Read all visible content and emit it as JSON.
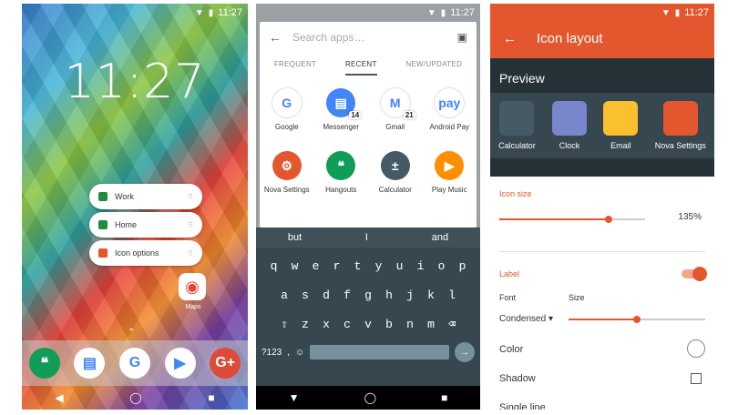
{
  "home": {
    "time": "11:27",
    "status_time": "11:27",
    "shortcuts": [
      {
        "label": "Work",
        "color": "#1e8e3e"
      },
      {
        "label": "Home",
        "color": "#1e8e3e"
      },
      {
        "label": "Icon options",
        "color": "#e4572e"
      }
    ],
    "maps_label": "Maps",
    "dock": [
      {
        "icon": "hangouts-icon",
        "color": "#0f9d58",
        "glyph": "❝"
      },
      {
        "icon": "messenger-icon",
        "color": "#ffffff",
        "glyph": "▤"
      },
      {
        "icon": "google-icon",
        "color": "#ffffff",
        "glyph": "G"
      },
      {
        "icon": "youtube-icon",
        "color": "#ffffff",
        "glyph": "▶"
      },
      {
        "icon": "google-plus-icon",
        "color": "#dd4b39",
        "glyph": "G+"
      }
    ]
  },
  "drawer": {
    "status_time": "11:27",
    "search_placeholder": "Search apps…",
    "tabs": [
      "FREQUENT",
      "RECENT",
      "NEW/UPDATED"
    ],
    "apps": [
      {
        "name": "Google",
        "color": "#ffffff",
        "glyph": "G",
        "badge": ""
      },
      {
        "name": "Messenger",
        "color": "#4285f4",
        "glyph": "▤",
        "badge": "14"
      },
      {
        "name": "Gmail",
        "color": "#ffffff",
        "glyph": "M",
        "badge": "21"
      },
      {
        "name": "Android Pay",
        "color": "#ffffff",
        "glyph": "pay",
        "badge": ""
      },
      {
        "name": "Nova Settings",
        "color": "#e4572e",
        "glyph": "⚙",
        "badge": ""
      },
      {
        "name": "Hangouts",
        "color": "#0f9d58",
        "glyph": "❝",
        "badge": ""
      },
      {
        "name": "Calculator",
        "color": "#455a64",
        "glyph": "±",
        "badge": ""
      },
      {
        "name": "Play Music",
        "color": "#ff8f00",
        "glyph": "▶",
        "badge": ""
      }
    ],
    "suggestions": [
      "but",
      "I",
      "and"
    ],
    "row1": [
      "q",
      "w",
      "e",
      "r",
      "t",
      "y",
      "u",
      "i",
      "o",
      "p"
    ],
    "row2": [
      "a",
      "s",
      "d",
      "f",
      "g",
      "h",
      "j",
      "k",
      "l"
    ],
    "row3": [
      "⇧",
      "z",
      "x",
      "c",
      "v",
      "b",
      "n",
      "m",
      "⌫"
    ],
    "sym": "?123",
    "comma": ","
  },
  "settings": {
    "status_time": "11:27",
    "title": "Icon layout",
    "preview_title": "Preview",
    "preview": [
      {
        "name": "Calculator",
        "color": "#455a64"
      },
      {
        "name": "Clock",
        "color": "#7986cb"
      },
      {
        "name": "Email",
        "color": "#fbc02d"
      },
      {
        "name": "Nova Settings",
        "color": "#e4572e"
      }
    ],
    "icon_size_label": "Icon size",
    "icon_size_value": "135%",
    "icon_size_level": 0.75,
    "label_label": "Label",
    "font_label": "Font",
    "size_label": "Size",
    "font_value": "Condensed",
    "size_level": 0.5,
    "color_label": "Color",
    "shadow_label": "Shadow",
    "single_line_label": "Single line"
  }
}
